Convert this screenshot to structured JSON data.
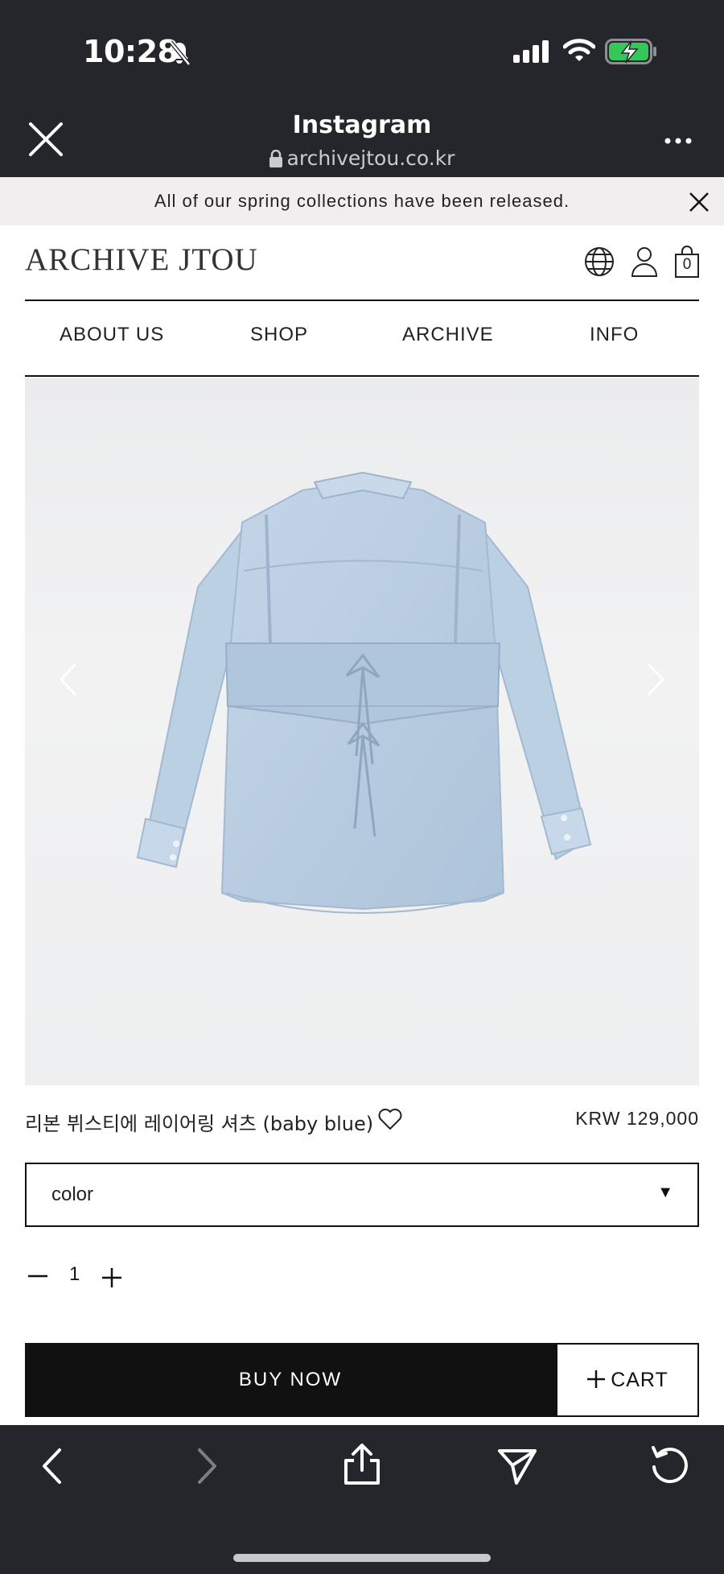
{
  "status_bar": {
    "time": "10:28"
  },
  "browser": {
    "title": "Instagram",
    "url": "archivejtou.co.kr"
  },
  "announcement": {
    "text": "All of our spring collections have been released."
  },
  "header": {
    "logo": "ARCHIVE JTOU",
    "cart_count": "0"
  },
  "nav": {
    "items": [
      "ABOUT US",
      "SHOP",
      "ARCHIVE",
      "INFO"
    ]
  },
  "product": {
    "name": "리본 뷔스티에 레이어링 셔츠 (baby blue)",
    "price": "KRW 129,000",
    "option_label": "color",
    "option_caret": "▼",
    "quantity": "1"
  },
  "actions": {
    "buy_now": "BUY NOW",
    "cart": "CART"
  },
  "colors": {
    "chrome": "#24262c",
    "banner": "#f0eeee",
    "buy_button": "#111111",
    "shirt": "#b7cbe0"
  }
}
